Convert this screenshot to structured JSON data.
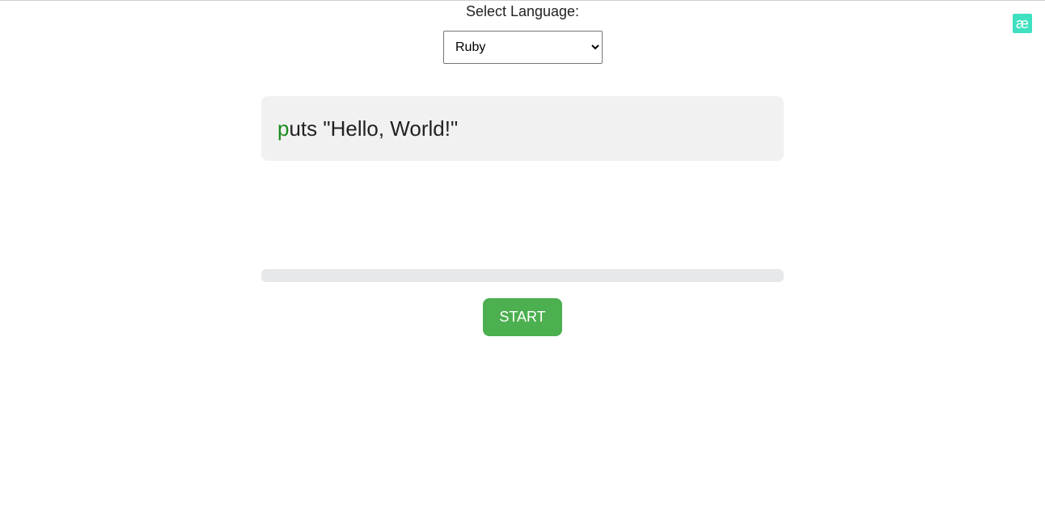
{
  "header": {
    "select_label": "Select Language:"
  },
  "language_select": {
    "selected": "Ruby",
    "options": [
      "Ruby"
    ]
  },
  "corner_badge": {
    "glyph": "æ",
    "icon": "ae-ligature-icon",
    "color": "#3ee0c0"
  },
  "code": {
    "typed": "p",
    "remaining": "uts \"Hello, World!\"",
    "typed_color": "#1e8a1e"
  },
  "progress": {
    "fraction": 0
  },
  "start_button": {
    "label": "START",
    "color": "#4caf50"
  }
}
